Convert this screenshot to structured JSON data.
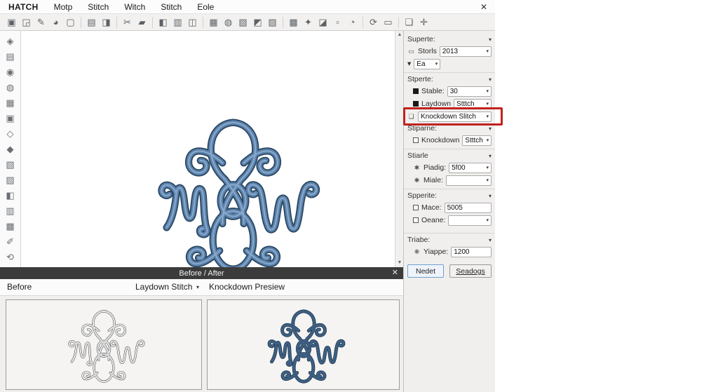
{
  "menu": {
    "items": [
      "HATCH",
      "Motp",
      "Stitch",
      "Witch",
      "Stitch",
      "Eole"
    ],
    "close": "✕"
  },
  "toolbar": {
    "icons": [
      "▣",
      "◲",
      "✎",
      "◕",
      "▢",
      "▤",
      "◨",
      "✂",
      "▰",
      "◧",
      "▥",
      "◫",
      "▦",
      "◍",
      "▧",
      "◩",
      "▨",
      "▩",
      "✦",
      "◪",
      "▫",
      "◔",
      "⟳",
      "▭",
      "❏",
      "✛"
    ]
  },
  "left_tools": {
    "icons": [
      "◈",
      "▤",
      "◉",
      "◍",
      "▦",
      "▣",
      "◇",
      "◆",
      "▧",
      "▨",
      "◧",
      "▥",
      "▩",
      "✐",
      "⟲"
    ]
  },
  "panel": {
    "section1": {
      "title": "Superte:",
      "storls_label": "Storls",
      "storls_value": "2013",
      "ea_value": "Ea"
    },
    "section2": {
      "title": "Stperte:",
      "stable_label": "Stable:",
      "stable_value": "30",
      "laydown_label": "Laydown",
      "laydown_value": "Stttch",
      "knockdown_value": "Knockdown Slitch"
    },
    "section3": {
      "title": "Stiparne:",
      "knockdown_label": "Knockdown",
      "knockdown_value": "Stttch"
    },
    "section4": {
      "title": "Stiarle",
      "padding_label": "Piadig:",
      "padding_value": "5f00",
      "miale_label": "Miale:",
      "miale_value": ""
    },
    "section5": {
      "title": "Spperite:",
      "mace_label": "Mace:",
      "mace_value": "5005",
      "oeane_label": "Oeane:",
      "oeane_value": ""
    },
    "section6": {
      "title": "Triabe:",
      "yiappe_label": "Yiappe:",
      "yiappe_value": "1200"
    },
    "buttons": {
      "nedet": "Nedet",
      "seadogs": "Seadogs"
    },
    "caret": "▾",
    "flake_icon": "✱",
    "flower_icon": "❋"
  },
  "before_after": {
    "title": "Before / After",
    "close": "✕",
    "before_label": "Before",
    "dropdown_value": "Laydown Stitch",
    "dropdown_caret": "▾",
    "preview_label": "Knockdown Presiew"
  },
  "scroll": {
    "up": "▲",
    "down": "▼"
  },
  "colors": {
    "highlight_red": "#c1221d",
    "stitch_blue": "#5d83ad",
    "stitch_outline": "#2c4a66",
    "panel_bg": "#f0efed",
    "header_bar": "#3b3b3b"
  }
}
